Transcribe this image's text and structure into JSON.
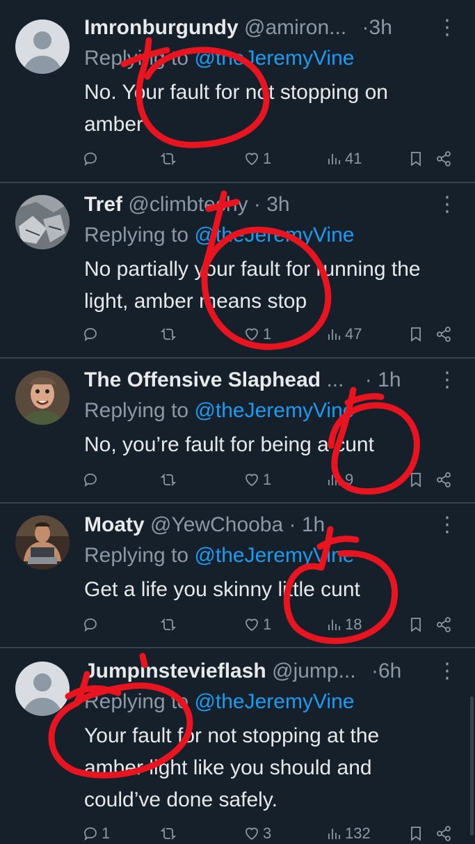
{
  "tweets": [
    {
      "name": "Imronburgundy",
      "handle": "@amiron...",
      "sep": "·",
      "time": "3h",
      "replying_prefix": "Replying to ",
      "replying_handle": "@theJeremyVine",
      "text": "No.  Your fault for not stopping on amber",
      "reply_count": "",
      "retweet_count": "",
      "like_count": "1",
      "view_count": "41",
      "avatar": "default-avatar"
    },
    {
      "name": "Tref",
      "handle": "@climbtechy",
      "sep": "·",
      "time": "3h",
      "replying_prefix": "Replying to ",
      "replying_handle": "@theJeremyVine",
      "text": "No partially your fault for running the light, amber means stop",
      "reply_count": "",
      "retweet_count": "",
      "like_count": "1",
      "view_count": "47",
      "avatar": "rock-photo-avatar"
    },
    {
      "name": "The Offensive Slaphead",
      "handle": "...",
      "sep": "·",
      "time": "1h",
      "replying_prefix": "Replying to ",
      "replying_handle": "@theJeremyVine",
      "text": "No, you’re fault for being a cunt",
      "reply_count": "",
      "retweet_count": "",
      "like_count": "1",
      "view_count": "9",
      "avatar": "face-photo-avatar"
    },
    {
      "name": "Moaty",
      "handle": "@YewChooba",
      "sep": "·",
      "time": "1h",
      "replying_prefix": "Replying to ",
      "replying_handle": "@theJeremyVine",
      "text": "Get a life you skinny little cunt",
      "reply_count": "",
      "retweet_count": "",
      "like_count": "1",
      "view_count": "18",
      "avatar": "person-photo-avatar"
    },
    {
      "name": "Jumpinstevieflash",
      "handle": "@jump...",
      "sep": "·",
      "time": "6h",
      "replying_prefix": "Replying to ",
      "replying_handle": "@theJeremyVine",
      "text": "Your fault for not stopping at the amber light like you should and could’ve done safely.",
      "reply_count": "1",
      "retweet_count": "",
      "like_count": "3",
      "view_count": "132",
      "avatar": "default-avatar"
    }
  ],
  "colors": {
    "background": "#15202b",
    "text": "#e7e9ea",
    "muted": "#8b98a5",
    "link": "#1d9bf0",
    "divider": "#38444d",
    "annotation": "#e8141f"
  },
  "icons": [
    "reply-icon",
    "retweet-icon",
    "like-icon",
    "views-icon",
    "bookmark-icon",
    "share-icon",
    "more-icon"
  ]
}
